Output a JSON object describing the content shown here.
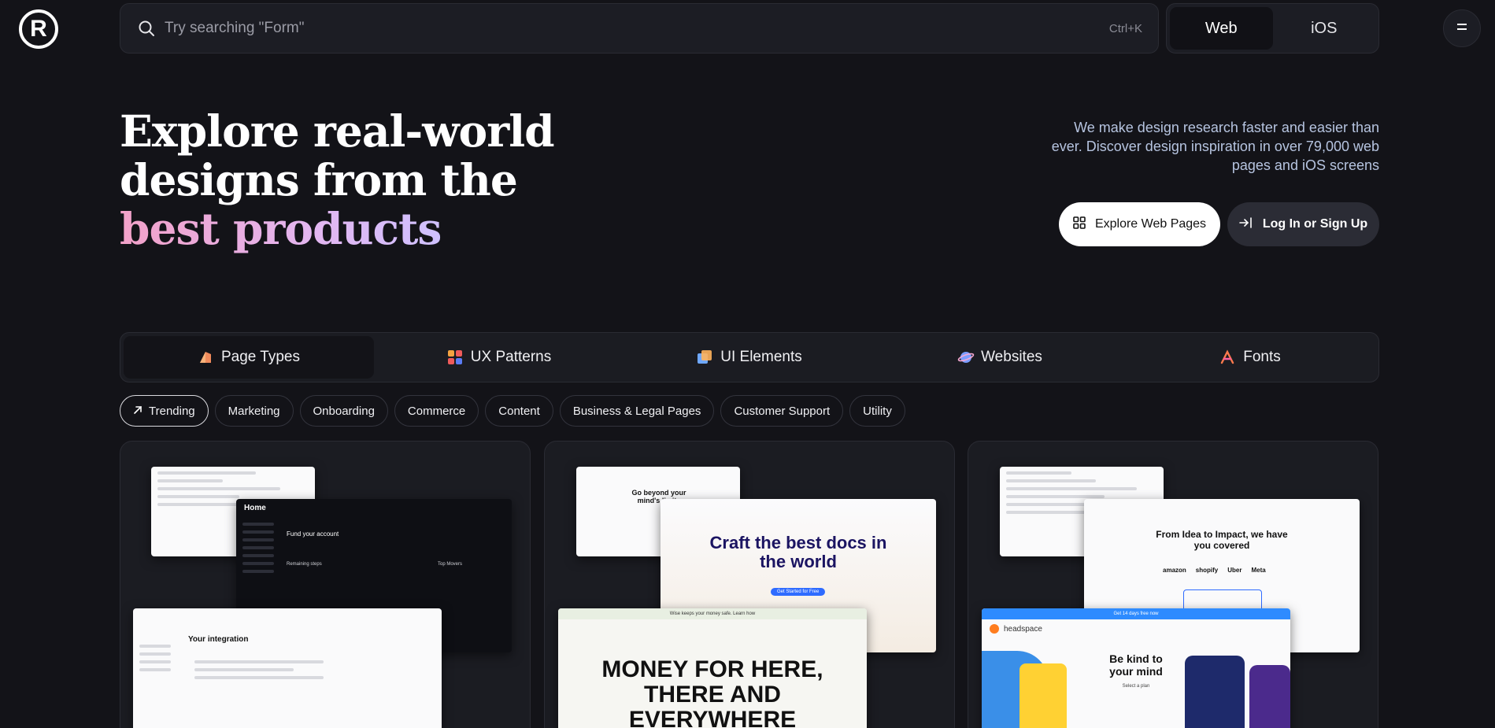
{
  "header": {
    "logo_glyph": "R",
    "search": {
      "placeholder": "Try searching \"Form\"",
      "shortcut": "Ctrl+K"
    },
    "platform_toggle": [
      {
        "label": "Web",
        "active": true
      },
      {
        "label": "iOS",
        "active": false
      }
    ]
  },
  "hero": {
    "title_line1": "Explore real-world",
    "title_line2": "designs from the",
    "title_line3": "best products",
    "description": "We make design research faster and easier than ever. Discover design inspiration in over 79,000 web pages and iOS screens",
    "explore_button": "Explore Web Pages",
    "login_button": "Log In or Sign Up"
  },
  "categories": [
    {
      "label": "Page Types",
      "icon": "page-types-icon",
      "active": true
    },
    {
      "label": "UX Patterns",
      "icon": "ux-patterns-icon",
      "active": false
    },
    {
      "label": "UI Elements",
      "icon": "ui-elements-icon",
      "active": false
    },
    {
      "label": "Websites",
      "icon": "websites-icon",
      "active": false
    },
    {
      "label": "Fonts",
      "icon": "fonts-icon",
      "active": false
    }
  ],
  "chips": [
    {
      "label": "Trending",
      "active": true
    },
    {
      "label": "Marketing"
    },
    {
      "label": "Onboarding"
    },
    {
      "label": "Commerce"
    },
    {
      "label": "Content"
    },
    {
      "label": "Business & Legal Pages"
    },
    {
      "label": "Customer Support"
    },
    {
      "label": "Utility"
    }
  ],
  "cards": {
    "card1": {
      "dark_shot_title": "Home",
      "dark_shot_heading": "Fund your account",
      "dark_shot_section": "Remaining steps",
      "dark_shot_side": "Top Movers",
      "white_shot_title": "Your integration"
    },
    "card2": {
      "top_shot_heading": "Go beyond your mind's limits",
      "main_heading": "Craft the best docs in the world",
      "main_cta": "Get Started for Free",
      "bottom_banner": "Wise keeps your money safe. Learn how",
      "bottom_heading": "MONEY FOR HERE, THERE AND EVERYWHERE"
    },
    "card3": {
      "main_heading": "From Idea to Impact, we have you covered",
      "logos": [
        "amazon",
        "shopify",
        "Uber",
        "Meta"
      ],
      "bottom_banner": "Get 14 days free now",
      "bottom_brand": "headspace",
      "bottom_heading": "Be kind to your mind",
      "bottom_sub": "Select a plan"
    }
  },
  "colors": {
    "background": "#131318",
    "surface": "#1b1c22",
    "accent_gradient_start": "#f2a1c8",
    "accent_gradient_end": "#cfc1ff"
  }
}
